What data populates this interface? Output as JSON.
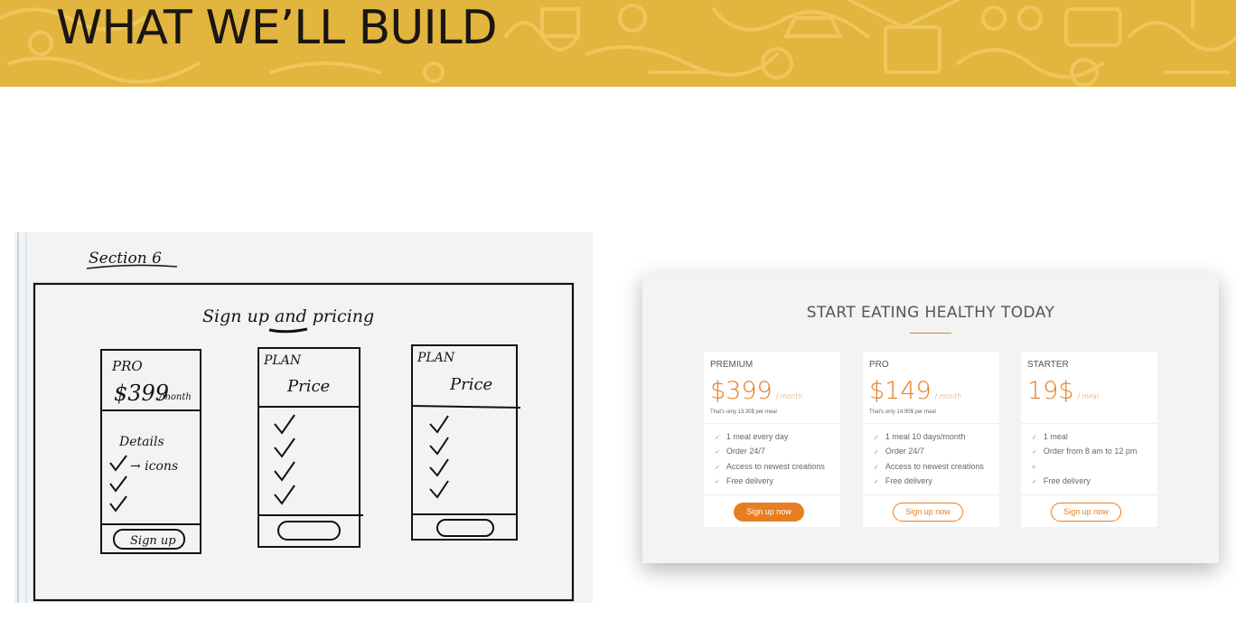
{
  "slide": {
    "title": "WHAT WE’LL BUILD"
  },
  "sketch": {
    "section": "Section 6",
    "heading": "Sign up and pricing",
    "cards": [
      {
        "plan": "PRO",
        "price": "$399",
        "unit": "/month",
        "details": "Details",
        "icons_note": "→ icons",
        "button": "Sign up"
      },
      {
        "plan": "PLAN",
        "price": "Price"
      },
      {
        "plan": "PLAN",
        "price": "Price"
      }
    ]
  },
  "mockup": {
    "title": "START EATING HEALTHY TODAY",
    "accent": "#e67e22",
    "plans": [
      {
        "name": "PREMIUM",
        "price": "$399",
        "unit": "/ month",
        "note": "That's only 13.30$ per meal",
        "features": [
          "1 meal every day",
          "Order 24/7",
          "Access to newest creations",
          "Free delivery"
        ],
        "button": "Sign up now",
        "style": "full"
      },
      {
        "name": "PRO",
        "price": "$149",
        "unit": "/ month",
        "note": "That's only 14.90$ per meal",
        "features": [
          "1 meal 10 days/month",
          "Order 24/7",
          "Access to newest creations",
          "Free delivery"
        ],
        "button": "Sign up now",
        "style": "ghost"
      },
      {
        "name": "STARTER",
        "price": "19$",
        "unit": "/ meal",
        "note": "",
        "features": [
          "1 meal",
          "Order from 8 am to 12 pm",
          "",
          "Free delivery"
        ],
        "button": "Sign up now",
        "style": "ghost"
      }
    ]
  }
}
